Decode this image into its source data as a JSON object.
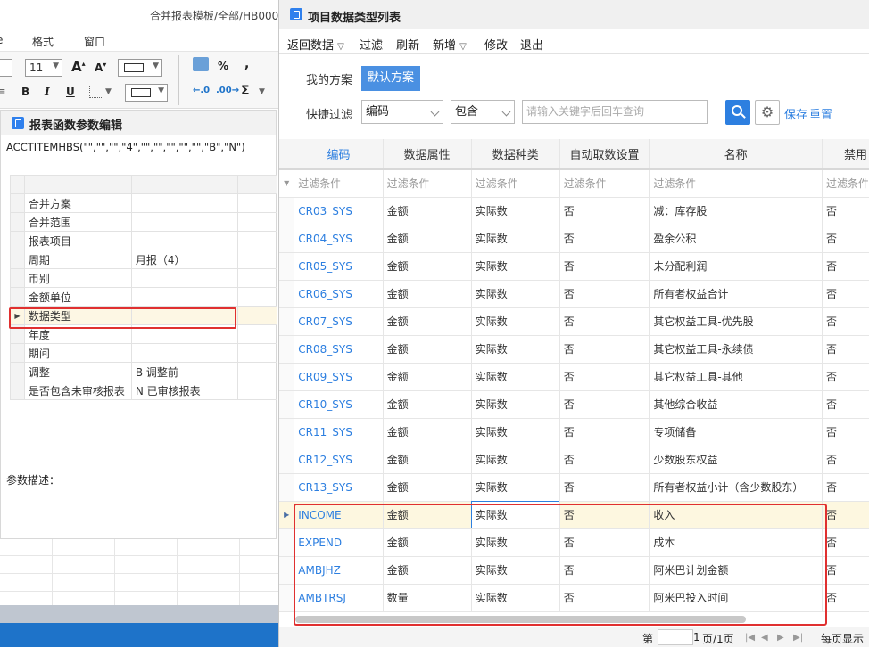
{
  "left_window": {
    "path": "合并报表模板/全部/HB000",
    "menu": [
      "格式",
      "窗口"
    ],
    "font_size": "11",
    "ribbon_symbols": {
      "percent": "%",
      "comma": ",",
      "sigma": "Σ",
      "bold": "B",
      "italic": "I",
      "underline": "U"
    }
  },
  "param_panel": {
    "title": "报表函数参数编辑",
    "formula": "ACCTITEMHBS(\"\",\"\",\"\",\"4\",\"\",\"\",\"\",\"\",\"\",\"B\",\"N\")",
    "rows": [
      {
        "name": "合并方案",
        "value": ""
      },
      {
        "name": "合并范围",
        "value": ""
      },
      {
        "name": "报表项目",
        "value": ""
      },
      {
        "name": "周期",
        "value": "月报（4）"
      },
      {
        "name": "币别",
        "value": ""
      },
      {
        "name": "金额单位",
        "value": ""
      },
      {
        "name": "数据类型",
        "value": ""
      },
      {
        "name": "年度",
        "value": ""
      },
      {
        "name": "期间",
        "value": ""
      },
      {
        "name": "调整",
        "value": "B  调整前"
      },
      {
        "name": "是否包含未审核报表",
        "value": "N  已审核报表"
      }
    ],
    "desc_label": "参数描述："
  },
  "dialog": {
    "title": "项目数据类型列表",
    "toolbar": [
      "返回数据",
      "过滤",
      "刷新",
      "新增",
      "修改",
      "退出"
    ],
    "my_scheme": "我的方案",
    "default_scheme": "默认方案",
    "quick_filter": "快捷过滤",
    "filter_field": "编码",
    "filter_op": "包含",
    "keyword_placeholder": "请输入关键字后回车查询",
    "save": "保存",
    "reset": "重置",
    "columns": [
      "编码",
      "数据属性",
      "数据种类",
      "自动取数设置",
      "名称",
      "禁用"
    ],
    "filter_row": "过滤条件",
    "rows": [
      {
        "code": "CR03_SYS",
        "attr": "金额",
        "kind": "实际数",
        "auto": "否",
        "name": "减：库存股",
        "disabled": "否"
      },
      {
        "code": "CR04_SYS",
        "attr": "金额",
        "kind": "实际数",
        "auto": "否",
        "name": "盈余公积",
        "disabled": "否"
      },
      {
        "code": "CR05_SYS",
        "attr": "金额",
        "kind": "实际数",
        "auto": "否",
        "name": "未分配利润",
        "disabled": "否"
      },
      {
        "code": "CR06_SYS",
        "attr": "金额",
        "kind": "实际数",
        "auto": "否",
        "name": "所有者权益合计",
        "disabled": "否"
      },
      {
        "code": "CR07_SYS",
        "attr": "金额",
        "kind": "实际数",
        "auto": "否",
        "name": "其它权益工具-优先股",
        "disabled": "否"
      },
      {
        "code": "CR08_SYS",
        "attr": "金额",
        "kind": "实际数",
        "auto": "否",
        "name": "其它权益工具-永续债",
        "disabled": "否"
      },
      {
        "code": "CR09_SYS",
        "attr": "金额",
        "kind": "实际数",
        "auto": "否",
        "name": "其它权益工具-其他",
        "disabled": "否"
      },
      {
        "code": "CR10_SYS",
        "attr": "金额",
        "kind": "实际数",
        "auto": "否",
        "name": "其他综合收益",
        "disabled": "否"
      },
      {
        "code": "CR11_SYS",
        "attr": "金额",
        "kind": "实际数",
        "auto": "否",
        "name": "专项储备",
        "disabled": "否"
      },
      {
        "code": "CR12_SYS",
        "attr": "金额",
        "kind": "实际数",
        "auto": "否",
        "name": "少数股东权益",
        "disabled": "否"
      },
      {
        "code": "CR13_SYS",
        "attr": "金额",
        "kind": "实际数",
        "auto": "否",
        "name": "所有者权益小计（含少数股东）",
        "disabled": "否"
      },
      {
        "code": "INCOME",
        "attr": "金额",
        "kind": "实际数",
        "auto": "否",
        "name": "收入",
        "disabled": "否"
      },
      {
        "code": "EXPEND",
        "attr": "金额",
        "kind": "实际数",
        "auto": "否",
        "name": "成本",
        "disabled": "否"
      },
      {
        "code": "AMBJHZ",
        "attr": "金额",
        "kind": "实际数",
        "auto": "否",
        "name": "阿米巴计划金额",
        "disabled": "否"
      },
      {
        "code": "AMBTRSJ",
        "attr": "数量",
        "kind": "实际数",
        "auto": "否",
        "name": "阿米巴投入时间",
        "disabled": "否"
      }
    ],
    "pager": {
      "prefix": "第",
      "page": "1",
      "pages": "页/1页",
      "per_page": "每页显示"
    }
  }
}
